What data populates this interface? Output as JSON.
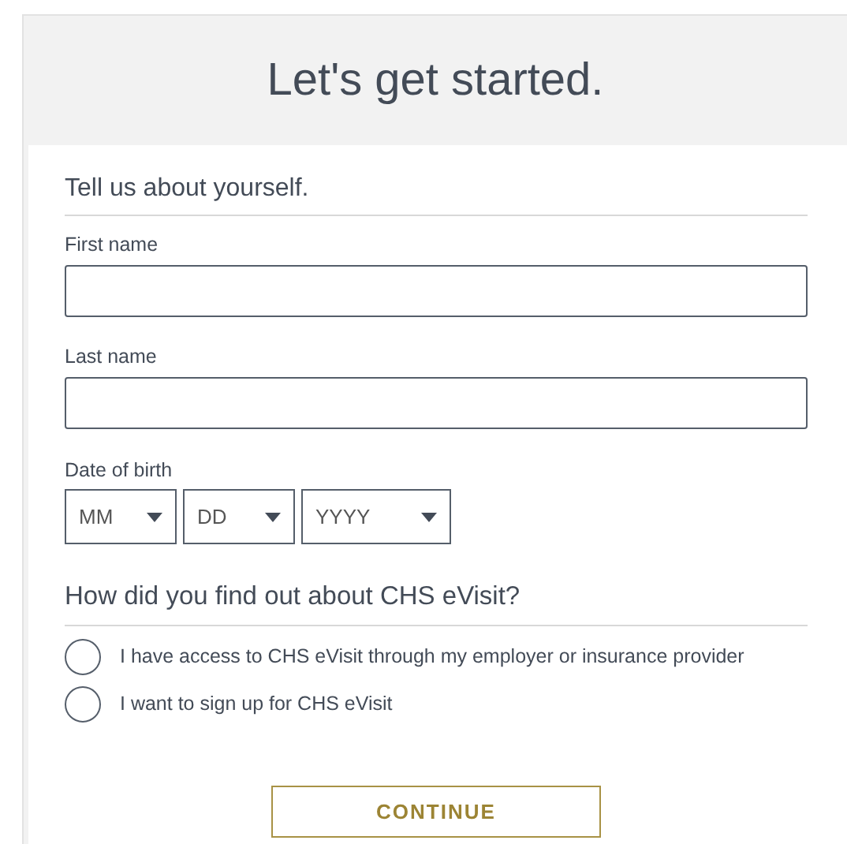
{
  "header": {
    "title": "Let's get started."
  },
  "about": {
    "heading": "Tell us about yourself.",
    "fields": [
      {
        "label": "First name"
      },
      {
        "label": "Last name"
      }
    ],
    "dob": {
      "label": "Date of birth",
      "selects": [
        {
          "placeholder": "MM"
        },
        {
          "placeholder": "DD"
        },
        {
          "placeholder": "YYYY"
        }
      ]
    }
  },
  "source": {
    "heading": "How did you find out about CHS eVisit?",
    "options": [
      {
        "label": "I have access to CHS eVisit through my employer or insurance provider",
        "selected": false
      },
      {
        "label": "I want to sign up for CHS eVisit",
        "selected": false
      }
    ]
  },
  "button": "CONTINUE"
}
